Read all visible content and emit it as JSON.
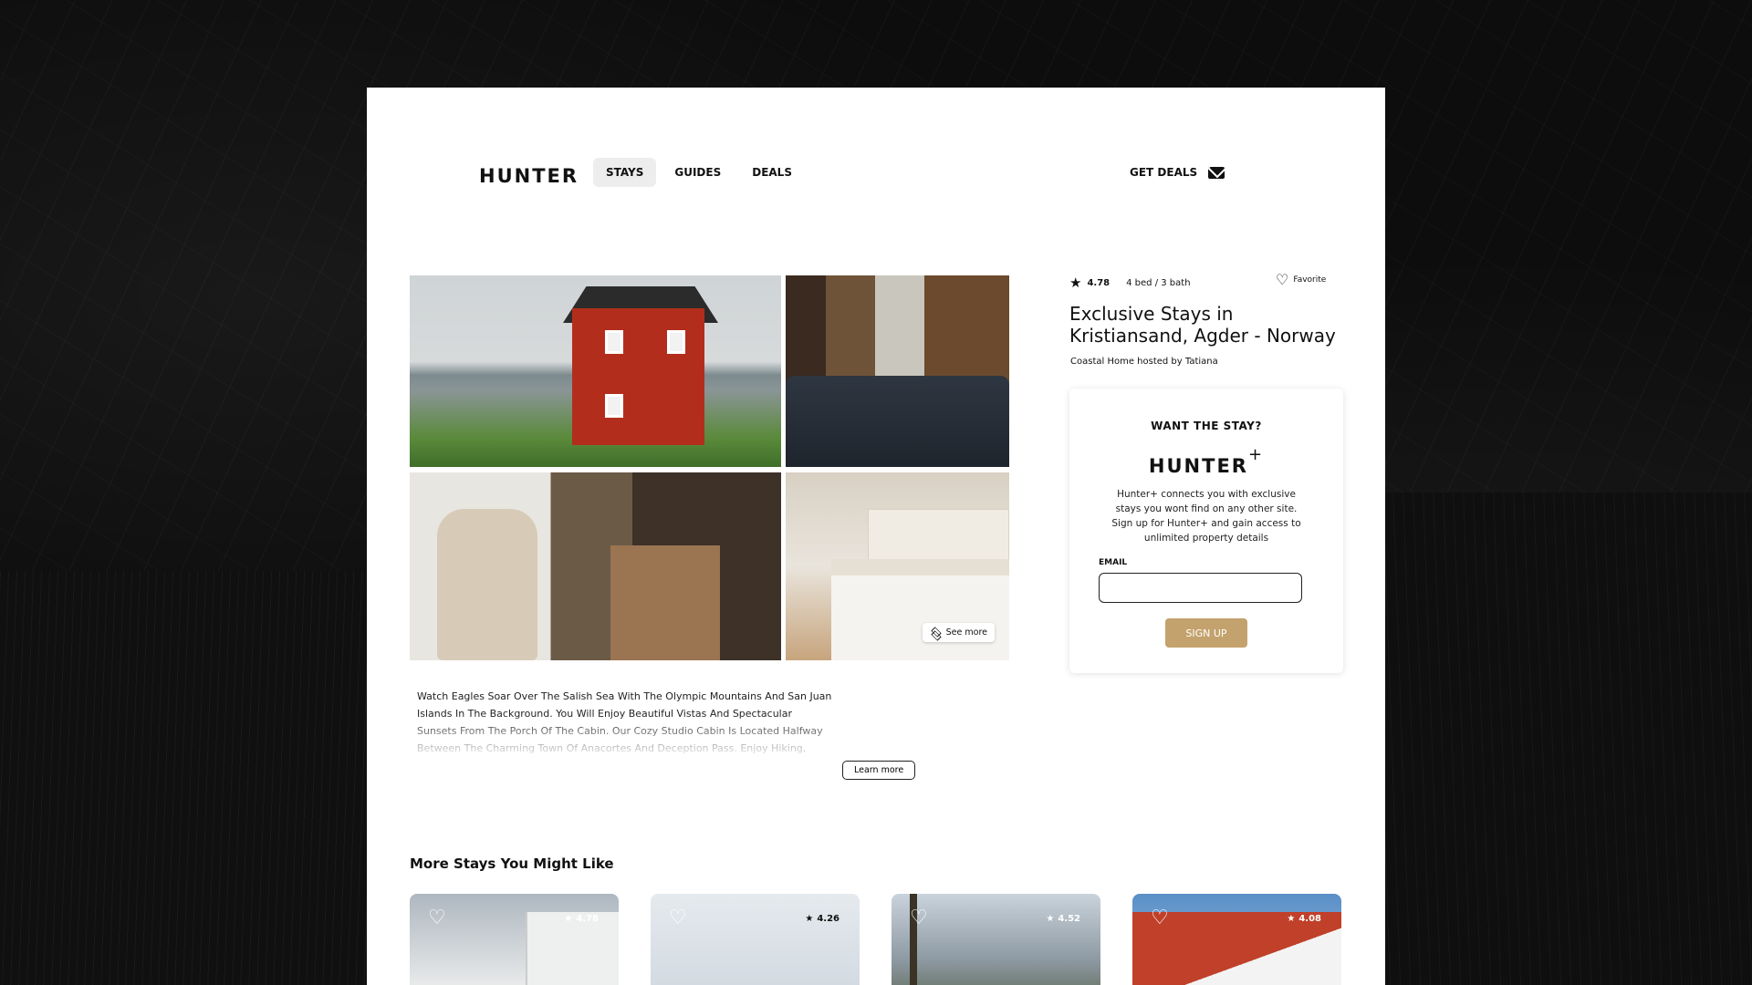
{
  "header": {
    "logo": "HUNTER",
    "nav": [
      {
        "label": "STAYS",
        "active": true
      },
      {
        "label": "GUIDES",
        "active": false
      },
      {
        "label": "DEALS",
        "active": false
      }
    ],
    "get_deals": "GET DEALS",
    "get_deals_icon": "mail-icon"
  },
  "gallery": {
    "see_more": "See more",
    "see_more_icon": "layers-icon"
  },
  "description": {
    "text": "Watch Eagles Soar Over The Salish Sea With The Olympic Mountains And San Juan Islands In The Background. You Will Enjoy Beautiful Vistas And Spectacular Sunsets From The Porch Of The Cabin. Our Cozy Studio Cabin Is Located Halfway Between The Charming Town Of Anacortes And Deception Pass. Enjoy Hiking, Fishing, Kayaking, And",
    "learn_more": "Learn more"
  },
  "listing": {
    "rating": "4.78",
    "beds_baths": "4 bed / 3 bath",
    "favorite": "Favorite",
    "title": "Exclusive Stays in Kristiansand, Agder - Norway",
    "host": "Coastal Home hosted by Tatiana"
  },
  "signup_card": {
    "question": "WANT THE STAY?",
    "logo": "HUNTER",
    "logo_plus": "+",
    "text": "Hunter+ connects you with exclusive stays you wont find on any other site. Sign up for Hunter+ and gain access to unlimited property details",
    "email_label": "EMAIL",
    "email_value": "",
    "button": "SIGN UP",
    "button_color": "#c4a26d"
  },
  "more_stays": {
    "title": "More Stays You Might Like",
    "items": [
      {
        "rating": "4.78"
      },
      {
        "rating": "4.26"
      },
      {
        "rating": "4.52"
      },
      {
        "rating": "4.08"
      }
    ]
  }
}
